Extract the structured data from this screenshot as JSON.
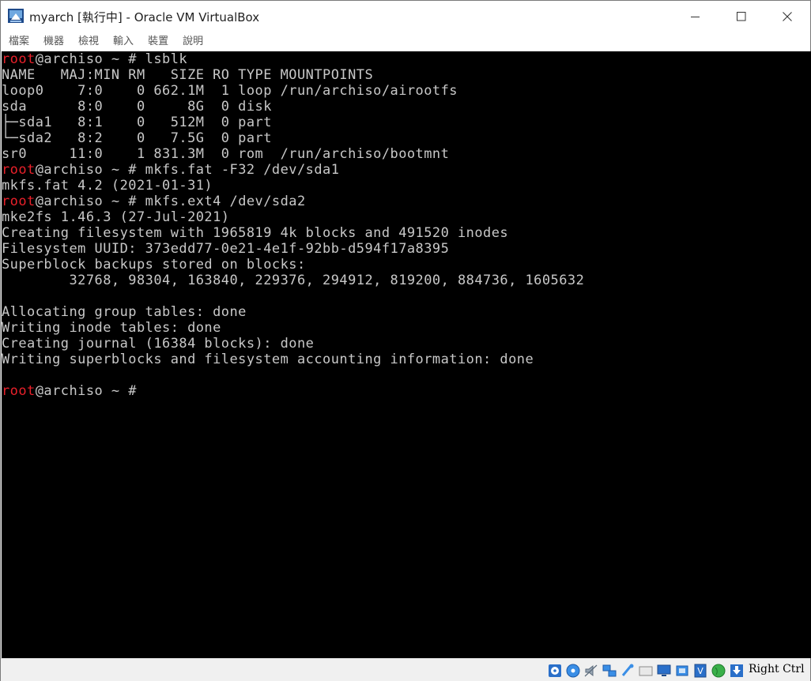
{
  "window": {
    "title": "myarch [執行中] - Oracle VM VirtualBox"
  },
  "menu": {
    "items": [
      "檔案",
      "機器",
      "檢視",
      "輸入",
      "裝置",
      "說明"
    ]
  },
  "terminal": {
    "prompt_user": "root",
    "prompt_rest": "@archiso ~ # ",
    "lines": [
      {
        "prompt": true,
        "text": "lsblk"
      },
      {
        "prompt": false,
        "text": "NAME   MAJ:MIN RM   SIZE RO TYPE MOUNTPOINTS"
      },
      {
        "prompt": false,
        "text": "loop0    7:0    0 662.1M  1 loop /run/archiso/airootfs"
      },
      {
        "prompt": false,
        "text": "sda      8:0    0     8G  0 disk"
      },
      {
        "prompt": false,
        "text": "├─sda1   8:1    0   512M  0 part"
      },
      {
        "prompt": false,
        "text": "└─sda2   8:2    0   7.5G  0 part"
      },
      {
        "prompt": false,
        "text": "sr0     11:0    1 831.3M  0 rom  /run/archiso/bootmnt"
      },
      {
        "prompt": true,
        "text": "mkfs.fat -F32 /dev/sda1"
      },
      {
        "prompt": false,
        "text": "mkfs.fat 4.2 (2021-01-31)"
      },
      {
        "prompt": true,
        "text": "mkfs.ext4 /dev/sda2"
      },
      {
        "prompt": false,
        "text": "mke2fs 1.46.3 (27-Jul-2021)"
      },
      {
        "prompt": false,
        "text": "Creating filesystem with 1965819 4k blocks and 491520 inodes"
      },
      {
        "prompt": false,
        "text": "Filesystem UUID: 373edd77-0e21-4e1f-92bb-d594f17a8395"
      },
      {
        "prompt": false,
        "text": "Superblock backups stored on blocks:"
      },
      {
        "prompt": false,
        "text": "        32768, 98304, 163840, 229376, 294912, 819200, 884736, 1605632"
      },
      {
        "prompt": false,
        "text": ""
      },
      {
        "prompt": false,
        "text": "Allocating group tables: done"
      },
      {
        "prompt": false,
        "text": "Writing inode tables: done"
      },
      {
        "prompt": false,
        "text": "Creating journal (16384 blocks): done"
      },
      {
        "prompt": false,
        "text": "Writing superblocks and filesystem accounting information: done"
      },
      {
        "prompt": false,
        "text": ""
      },
      {
        "prompt": true,
        "text": ""
      }
    ]
  },
  "statusbar": {
    "icons": [
      "optical-drive-icon",
      "cd-disc-icon",
      "audio-icon",
      "network-icon",
      "usb-icon",
      "shared-folder-icon",
      "display-icon",
      "recording-icon",
      "virtualization-icon",
      "globe-icon",
      "arrow-down-icon"
    ],
    "host_key": "Right Ctrl"
  }
}
